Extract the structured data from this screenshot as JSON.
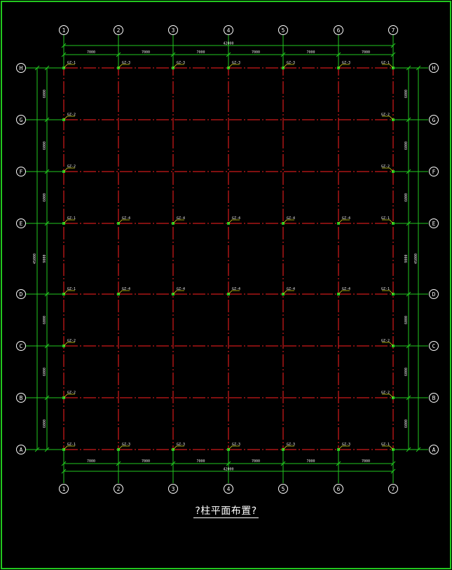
{
  "drawing": {
    "title": "?柱平面布置?",
    "colors": {
      "background": "#000000",
      "frame": "#22c71f",
      "grid": "#ff2020",
      "dimension": "#22c71f",
      "bubble": "#ffffff",
      "label": "#e6e6e6",
      "leader": "#d9d91a"
    },
    "columns": [
      "1",
      "2",
      "3",
      "4",
      "5",
      "6",
      "7"
    ],
    "rows": [
      "H",
      "G",
      "F",
      "E",
      "D",
      "C",
      "B",
      "A"
    ],
    "column_spacing_labels": [
      "7000",
      "7000",
      "7000",
      "7000",
      "7000",
      "7000"
    ],
    "column_total_label": "42000",
    "row_spacing_labels_left": [
      "6000",
      "6000",
      "6000",
      "9000",
      "6000",
      "6000",
      "6000"
    ],
    "row_spacing_labels_right": [
      "6000",
      "6000",
      "6000",
      "9000",
      "6000",
      "6000",
      "6000"
    ],
    "row_total_label": "45000",
    "column_tags": [
      [
        "GZ-1",
        "GZ-3",
        "GZ-3",
        "GZ-3",
        "GZ-3",
        "GZ-3",
        "GZ-1"
      ],
      [
        "GZ-2",
        "",
        "",
        "",
        "",
        "",
        "GZ-2"
      ],
      [
        "GZ-2",
        "",
        "",
        "",
        "",
        "",
        "GZ-2"
      ],
      [
        "GZ-1",
        "GZ-4",
        "GZ-4",
        "GZ-4",
        "GZ-4",
        "GZ-4",
        "GZ-1"
      ],
      [
        "GZ-1",
        "GZ-4",
        "GZ-4",
        "GZ-4",
        "GZ-4",
        "GZ-4",
        "GZ-1"
      ],
      [
        "GZ-2",
        "",
        "",
        "",
        "",
        "",
        "GZ-2"
      ],
      [
        "GZ-2",
        "",
        "",
        "",
        "",
        "",
        "GZ-2"
      ],
      [
        "GZ-1",
        "GZ-3",
        "GZ-3",
        "GZ-3",
        "GZ-3",
        "GZ-3",
        "GZ-1"
      ]
    ]
  }
}
